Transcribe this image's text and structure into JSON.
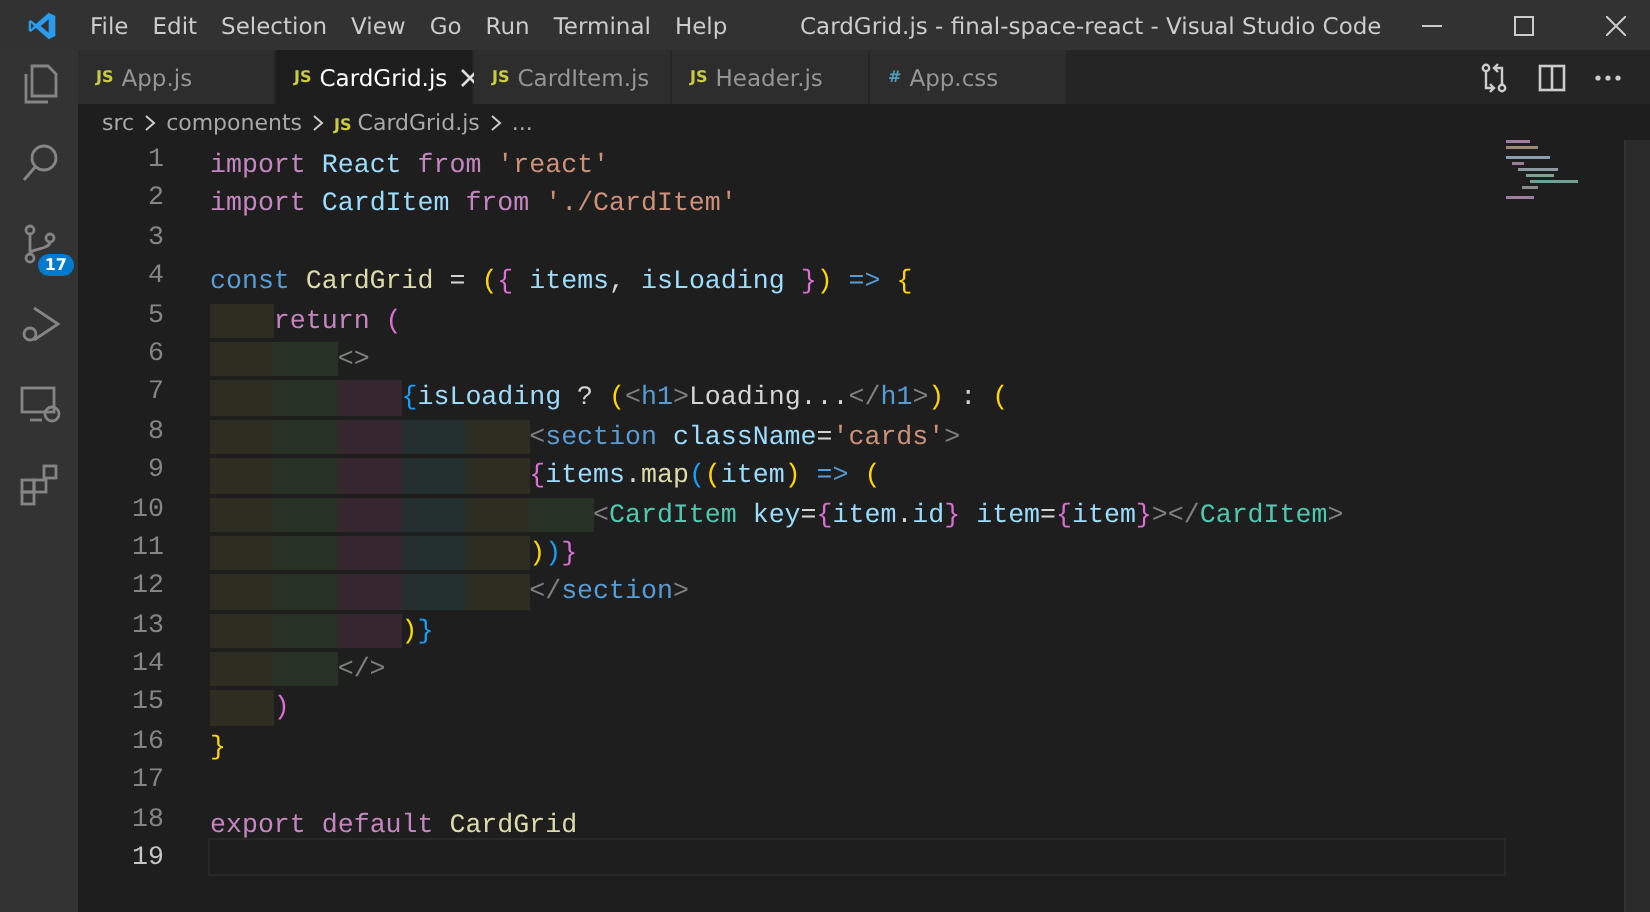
{
  "window": {
    "title": "CardGrid.js - final-space-react - Visual Studio Code"
  },
  "menu": [
    "File",
    "Edit",
    "Selection",
    "View",
    "Go",
    "Run",
    "Terminal",
    "Help"
  ],
  "activity_bar": [
    {
      "kind": "files",
      "selected": false
    },
    {
      "kind": "search",
      "selected": false
    },
    {
      "kind": "source-control",
      "selected": false,
      "badge": "17"
    },
    {
      "kind": "run",
      "selected": false
    },
    {
      "kind": "remote",
      "selected": false
    },
    {
      "kind": "extensions",
      "selected": false
    }
  ],
  "tabs": [
    {
      "icon": "JS",
      "label": "App.js",
      "selected": false
    },
    {
      "icon": "JS",
      "label": "CardGrid.js",
      "selected": true
    },
    {
      "icon": "JS",
      "label": "CardItem.js",
      "selected": false
    },
    {
      "icon": "JS",
      "label": "Header.js",
      "selected": false
    },
    {
      "icon": "#",
      "label": "App.css",
      "selected": false
    }
  ],
  "breadcrumb": [
    {
      "label": "src"
    },
    {
      "label": "components"
    },
    {
      "icon": "JS",
      "label": "CardGrid.js"
    },
    {
      "label": "..."
    }
  ],
  "lines": [
    {
      "number": "1",
      "current": false,
      "text": "import React from 'react'"
    },
    {
      "number": "2",
      "current": false,
      "text": "import CardItem from './CardItem'"
    },
    {
      "number": "3",
      "current": false
    },
    {
      "number": "4",
      "current": false,
      "text": "const CardGrid = ({ items, isLoading }) => {"
    },
    {
      "number": "5",
      "current": false,
      "text": "    return ("
    },
    {
      "number": "6",
      "current": false,
      "text": "        <>"
    },
    {
      "number": "7",
      "current": false,
      "text": "            {isLoading ? (<h1>Loading...</h1>) : ("
    },
    {
      "number": "8",
      "current": false,
      "text": "                    <section className='cards'>"
    },
    {
      "number": "9",
      "current": false,
      "text": "                    {items.map((item) => ("
    },
    {
      "number": "10",
      "current": false,
      "text": "                        <CardItem key={item.id} item={item}></CardItem>"
    },
    {
      "number": "11",
      "current": false,
      "text": "                    ))}"
    },
    {
      "number": "12",
      "current": false,
      "text": "                    </section>"
    },
    {
      "number": "13",
      "current": false,
      "text": "            )}"
    },
    {
      "number": "14",
      "current": false,
      "text": "        </>"
    },
    {
      "number": "15",
      "current": false,
      "text": "    )"
    },
    {
      "number": "16",
      "current": false,
      "text": "}"
    },
    {
      "number": "17",
      "current": false
    },
    {
      "number": "18",
      "current": false,
      "text": "export default CardGrid"
    },
    {
      "number": "19",
      "current": true
    }
  ]
}
